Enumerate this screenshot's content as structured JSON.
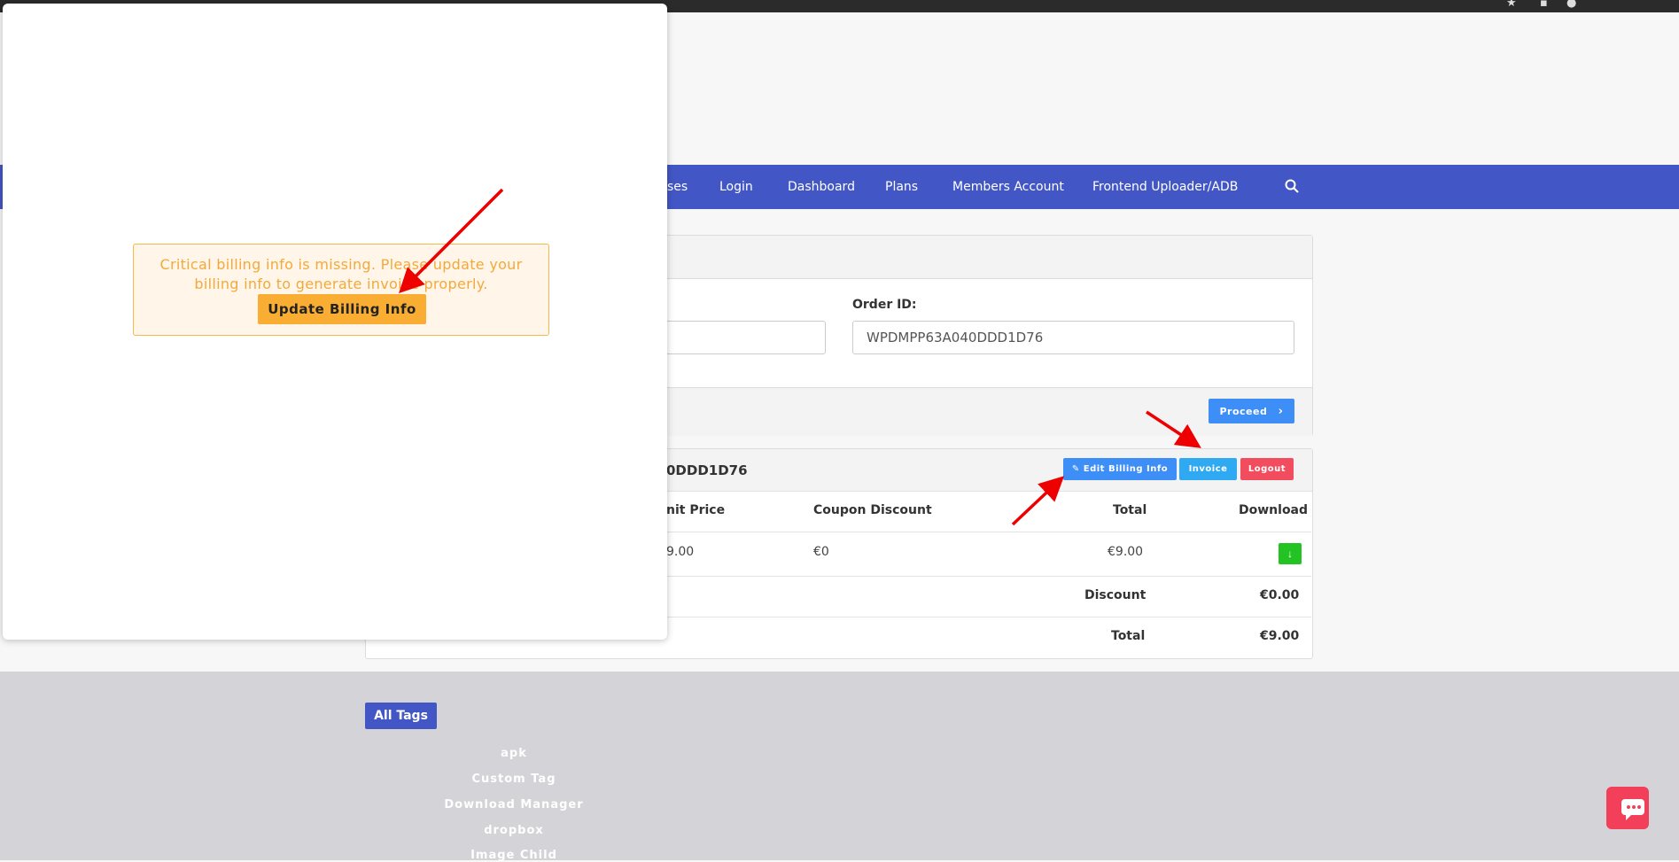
{
  "nav": {
    "items": [
      "ses",
      "Login",
      "Dashboard",
      "Plans",
      "Members Account",
      "Frontend Uploader/ADB"
    ]
  },
  "order_form": {
    "order_id_label": "Order ID:",
    "order_id_value": "WPDMPP63A040DDD1D76",
    "proceed_label": "Proceed"
  },
  "order_card": {
    "title_fragment": "0DDD1D76",
    "edit_billing_label": "Edit Billing Info",
    "invoice_label": "Invoice",
    "logout_label": "Logout",
    "columns": [
      "nit Price",
      "Coupon Discount",
      "Total",
      "Download"
    ],
    "row": {
      "unit_price": "9.00",
      "coupon_discount": "€0",
      "total": "€9.00"
    },
    "discount_label": "Discount",
    "discount_value": "€0.00",
    "total_label": "Total",
    "total_value": "€9.00"
  },
  "footer": {
    "all_tags_label": "All Tags",
    "tags": [
      "apk",
      "Custom Tag",
      "Download Manager",
      "dropbox",
      "Image Child"
    ]
  },
  "popup": {
    "alert_line1": "Critical billing info is missing. Please update your",
    "alert_line2": "billing info to generate invoice properly.",
    "update_button_label": "Update Billing Info"
  },
  "colors": {
    "nav_bg": "#4257c5",
    "alert_text": "#f3a93a",
    "update_button": "#f9ad32",
    "edit_button": "#3e8ef7",
    "invoice_button": "#2ea9f2",
    "logout_button": "#f24d5f",
    "download_button": "#22c322",
    "arrow": "#ee0000"
  }
}
